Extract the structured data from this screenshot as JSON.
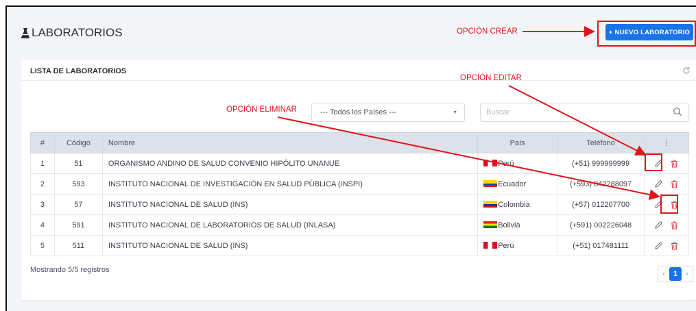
{
  "header": {
    "title": "LABORATORIOS",
    "title_icon": "flask-icon",
    "new_button_label": "+ NUEVO LABORATORIO"
  },
  "annotations": {
    "crear": "OPCIÓN CREAR",
    "editar": "OPCIÓN EDITAR",
    "eliminar": "OPCIÓN ELIMINAR",
    "color": "#e3121b"
  },
  "card": {
    "title": "LISTA DE LABORATORIOS",
    "refresh_icon": "refresh-icon"
  },
  "filters": {
    "country_select_value": "--- Todos los Países ---",
    "search_placeholder": "Buscar"
  },
  "table": {
    "columns": [
      "#",
      "Código",
      "Nombre",
      "País",
      "Teléfono",
      "⋮"
    ],
    "rows": [
      {
        "num": "1",
        "codigo": "51",
        "nombre": "ORGANISMO ANDINO DE SALUD CONVENIO HIPÓLITO UNANUE",
        "pais": "Perú",
        "flag": "pe",
        "telefono": "(+51) 999999999"
      },
      {
        "num": "2",
        "codigo": "593",
        "nombre": "INSTITUTO NACIONAL DE INVESTIGACIÓN EN SALUD PÚBLICA (INSPI)",
        "pais": "Ecuador",
        "flag": "ec",
        "telefono": "(+593) 042288097"
      },
      {
        "num": "3",
        "codigo": "57",
        "nombre": "INSTITUTO NACIONAL DE SALUD (INS)",
        "pais": "Colombia",
        "flag": "co",
        "telefono": "(+57) 012207700"
      },
      {
        "num": "4",
        "codigo": "591",
        "nombre": "INSTITUTO NACIONAL DE LABORATORIOS DE SALUD (INLASA)",
        "pais": "Bolivia",
        "flag": "bo",
        "telefono": "(+591) 002226048"
      },
      {
        "num": "5",
        "codigo": "511",
        "nombre": "INSTITUTO NACIONAL DE SALUD (INS)",
        "pais": "Perú",
        "flag": "pe",
        "telefono": "(+51) 017481111"
      }
    ]
  },
  "footer": {
    "records_text": "Mostrando 5/5 registros",
    "current_page": "1",
    "prev": "‹",
    "next": "›"
  },
  "colors": {
    "primary": "#1a73e8",
    "delete": "#e0424f",
    "header_bg": "#dde1ea"
  }
}
